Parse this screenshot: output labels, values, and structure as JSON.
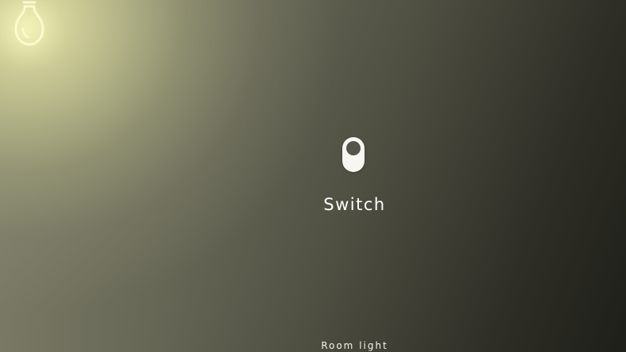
{
  "switch": {
    "label": "Switch",
    "state": "on"
  },
  "footer": {
    "room_label": "Room light"
  },
  "icons": {
    "bulb": "light-bulb-icon",
    "toggle": "toggle-switch-icon"
  },
  "colors": {
    "glow": "#ecebaa",
    "background_dark": "#1f1f1a",
    "switch_body": "#f7f7f2",
    "switch_knob": "#55554a"
  }
}
